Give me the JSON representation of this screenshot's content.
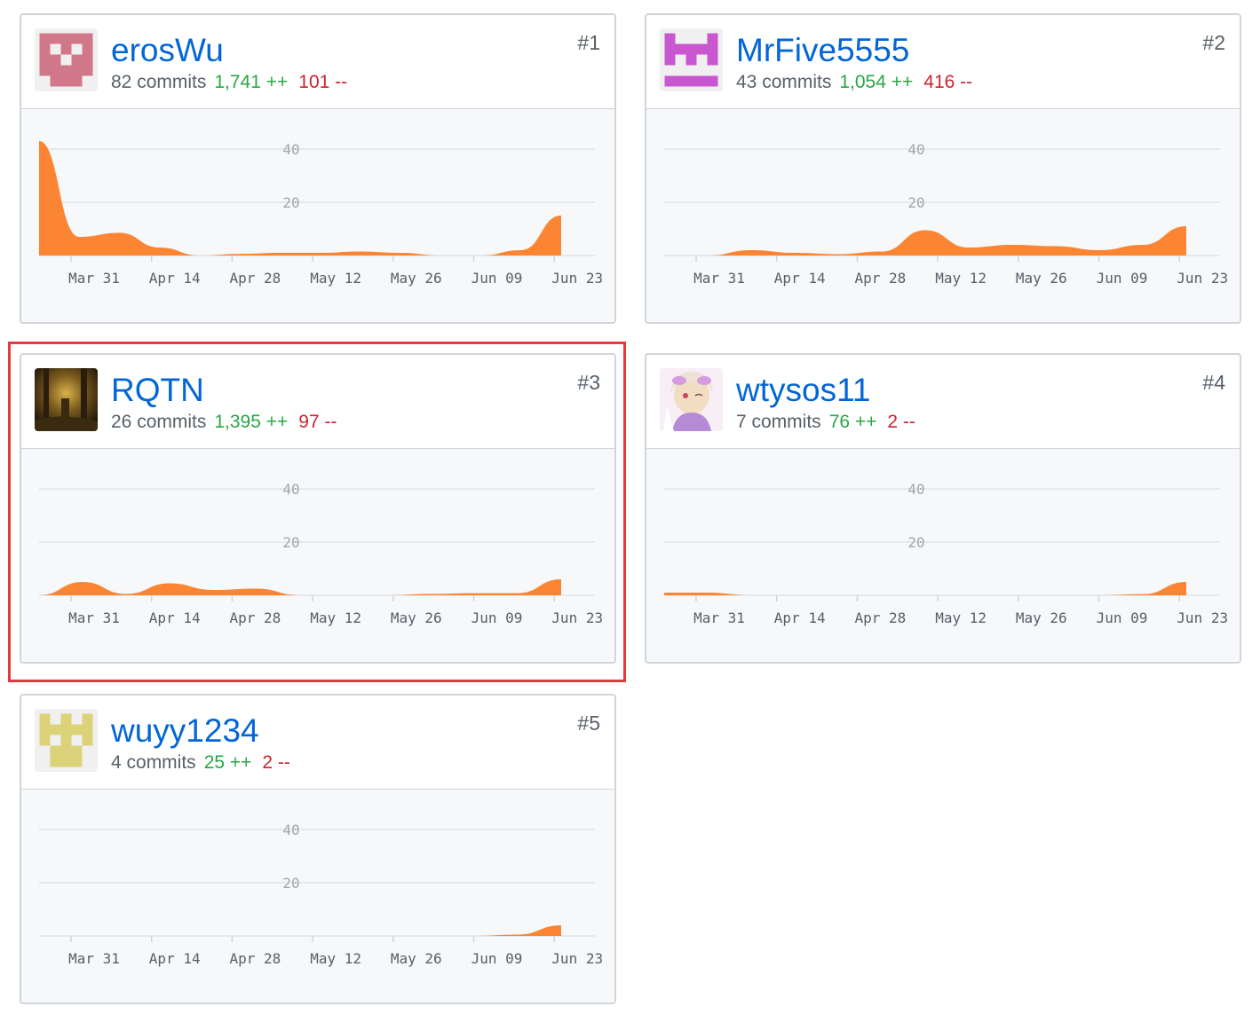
{
  "highlight_color": "#e5393e",
  "colors": {
    "username": "#0366d6",
    "additions": "#28a745",
    "deletions": "#cb2431",
    "area": "#fb8532"
  },
  "contributors": [
    {
      "username": "erosWu",
      "commits_text": "82 commits",
      "additions_text": "1,741 ++",
      "deletions_text": "101 --",
      "rank": "#1",
      "avatar": {
        "type": "identicon",
        "color": "#d27789",
        "pattern": [
          "11111",
          "10101",
          "11011",
          "11111",
          "01110"
        ]
      },
      "chart_data": {
        "type": "area",
        "y_ticks": [
          "40",
          "20"
        ],
        "ylim": [
          0,
          45
        ],
        "x_labels": [
          "Mar 31",
          "Apr 14",
          "Apr 28",
          "May 12",
          "May 26",
          "Jun 09",
          "Jun 23"
        ],
        "values": [
          43,
          7,
          8.5,
          3,
          0,
          0.6,
          1,
          1,
          1.5,
          1,
          0,
          0,
          2,
          15
        ]
      },
      "highlighted": false
    },
    {
      "username": "MrFive5555",
      "commits_text": "43 commits",
      "additions_text": "1,054 ++",
      "deletions_text": "416 --",
      "rank": "#2",
      "avatar": {
        "type": "identicon",
        "color": "#c958d0",
        "pattern": [
          "10001",
          "11111",
          "10101",
          "00000",
          "11111"
        ]
      },
      "chart_data": {
        "type": "area",
        "y_ticks": [
          "40",
          "20"
        ],
        "ylim": [
          0,
          45
        ],
        "x_labels": [
          "Mar 31",
          "Apr 14",
          "Apr 28",
          "May 12",
          "May 26",
          "Jun 09",
          "Jun 23"
        ],
        "values": [
          0,
          0,
          2,
          1,
          0.5,
          1.5,
          9.5,
          3,
          4,
          3.5,
          2,
          4,
          11
        ]
      },
      "highlighted": false
    },
    {
      "username": "RQTN",
      "commits_text": "26 commits",
      "additions_text": "1,395 ++",
      "deletions_text": "97 --",
      "rank": "#3",
      "avatar": {
        "type": "photo"
      },
      "chart_data": {
        "type": "area",
        "y_ticks": [
          "40",
          "20"
        ],
        "ylim": [
          0,
          45
        ],
        "x_labels": [
          "Mar 31",
          "Apr 14",
          "Apr 28",
          "May 12",
          "May 26",
          "Jun 09",
          "Jun 23"
        ],
        "values": [
          0,
          5,
          0.5,
          4.5,
          2,
          2.5,
          0,
          0,
          0,
          0.5,
          0.8,
          0.8,
          6
        ]
      },
      "highlighted": true
    },
    {
      "username": "wtysos11",
      "commits_text": "7 commits",
      "additions_text": "76 ++",
      "deletions_text": "2 --",
      "rank": "#4",
      "avatar": {
        "type": "photo"
      },
      "chart_data": {
        "type": "area",
        "y_ticks": [
          "40",
          "20"
        ],
        "ylim": [
          0,
          45
        ],
        "x_labels": [
          "Mar 31",
          "Apr 14",
          "Apr 28",
          "May 12",
          "May 26",
          "Jun 09",
          "Jun 23"
        ],
        "values": [
          1,
          1,
          0,
          0,
          0,
          0,
          0,
          0,
          0,
          0,
          0,
          0.4,
          5
        ]
      },
      "highlighted": false
    },
    {
      "username": "wuyy1234",
      "commits_text": "4 commits",
      "additions_text": "25 ++",
      "deletions_text": "2 --",
      "rank": "#5",
      "avatar": {
        "type": "identicon",
        "color": "#dcd27a",
        "pattern": [
          "10101",
          "11111",
          "10101",
          "01110",
          "01110"
        ]
      },
      "chart_data": {
        "type": "area",
        "y_ticks": [
          "40",
          "20"
        ],
        "ylim": [
          0,
          45
        ],
        "x_labels": [
          "Mar 31",
          "Apr 14",
          "Apr 28",
          "May 12",
          "May 26",
          "Jun 09",
          "Jun 23"
        ],
        "values": [
          0,
          0,
          0,
          0,
          0,
          0,
          0,
          0,
          0,
          0,
          0,
          0.5,
          4
        ]
      },
      "highlighted": false
    }
  ]
}
